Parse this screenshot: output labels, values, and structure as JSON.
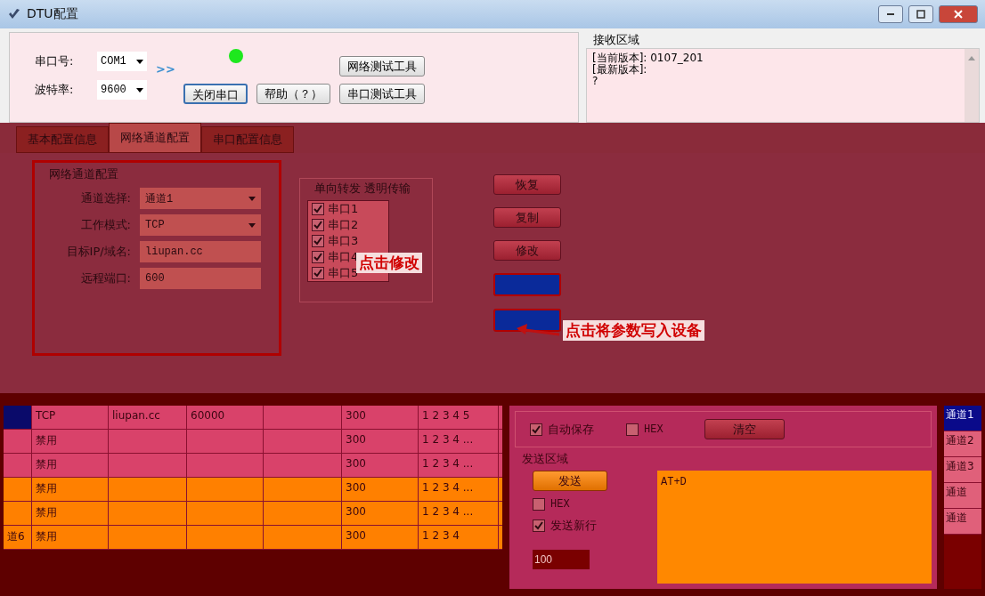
{
  "window": {
    "title": "DTU配置"
  },
  "serial": {
    "port_label": "串口号:",
    "port": "COM1",
    "baud_label": "波特率:",
    "baud": "9600",
    "arrow": ">>",
    "connected": true
  },
  "top_buttons": [
    {
      "label": "关闭串口",
      "focused": true
    },
    {
      "label": "帮助（？）",
      "focused": false
    },
    {
      "label": "网络测试工具",
      "focused": false
    },
    {
      "label": "串口测试工具",
      "focused": false
    }
  ],
  "receive": {
    "title": "接收区域",
    "lines": [
      "[当前版本]: 0107_201",
      "[最新版本]:",
      "?"
    ]
  },
  "tabs": [
    {
      "label": "基本配置信息",
      "selected": false
    },
    {
      "label": "网络通道配置",
      "selected": true
    },
    {
      "label": "串口配置信息",
      "selected": false
    }
  ],
  "channel_config": {
    "title": "网络通道配置",
    "fields": [
      {
        "label": "通道选择:",
        "value": "通道1",
        "kind": "select"
      },
      {
        "label": "工作模式:",
        "value": "TCP",
        "kind": "select"
      },
      {
        "label": "目标IP/域名:",
        "value": "liupan.cc",
        "kind": "input"
      },
      {
        "label": "远程端口:",
        "value": "600",
        "kind": "input"
      }
    ]
  },
  "forward": {
    "title": "单向转发 透明传输",
    "ports": [
      {
        "label": "串口1",
        "checked": true
      },
      {
        "label": "串口2",
        "checked": true
      },
      {
        "label": "串口3",
        "checked": true
      },
      {
        "label": "串口4",
        "checked": true
      },
      {
        "label": "串口5",
        "checked": true
      }
    ]
  },
  "side_buttons": [
    "恢复",
    "复制",
    "修改"
  ],
  "annotations": [
    "点击修改",
    "点击将参数写入设备"
  ],
  "table": {
    "rows": [
      {
        "cells": [
          "",
          "TCP",
          "liupan.cc",
          "60000",
          "",
          "300",
          "1 2 3 4 5"
        ],
        "selected": true
      },
      {
        "cells": [
          "",
          "禁用",
          "",
          "",
          "",
          "300",
          "1 2 3 4 ..."
        ],
        "selected": false
      },
      {
        "cells": [
          "",
          "禁用",
          "",
          "",
          "",
          "300",
          "1 2 3 4 ..."
        ],
        "selected": false
      },
      {
        "cells": [
          "",
          "禁用",
          "",
          "",
          "",
          "300",
          "1 2 3 4 ..."
        ],
        "selected": false
      },
      {
        "cells": [
          "",
          "禁用",
          "",
          "",
          "",
          "300",
          "1 2 3 4 ..."
        ],
        "selected": false
      },
      {
        "cells": [
          "道6",
          "禁用",
          "",
          "",
          "",
          "300",
          "1 2 3 4"
        ],
        "selected": false
      }
    ]
  },
  "receive_options": {
    "auto_save": {
      "label": "自动保存",
      "checked": true
    },
    "hex": {
      "label": "HEX",
      "checked": false
    },
    "clear": "清空"
  },
  "send": {
    "title": "发送区域",
    "value": "AT+D",
    "button": "发送",
    "hex": {
      "label": "HEX",
      "checked": false
    },
    "newline": {
      "label": "发送新行",
      "checked": true
    },
    "interval": "100"
  },
  "channel_list": [
    {
      "label": "通道1",
      "selected": true
    },
    {
      "label": "通道2",
      "selected": false
    },
    {
      "label": "通道3",
      "selected": false
    },
    {
      "label": "通道",
      "selected": false
    },
    {
      "label": "通道",
      "selected": false
    }
  ]
}
